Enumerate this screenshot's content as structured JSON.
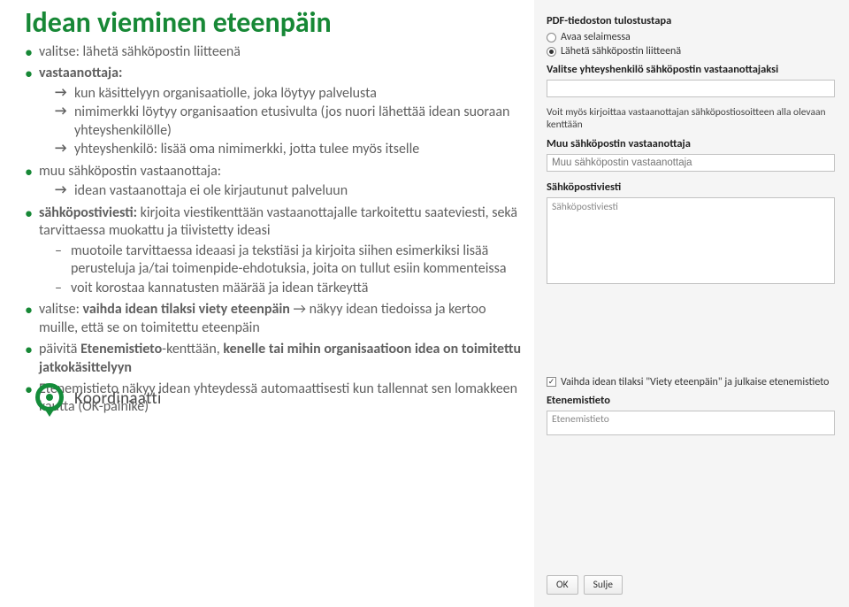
{
  "title": "Idean vieminen eteenpäin",
  "bullets": {
    "b1": "valitse: lähetä sähköpostin liitteenä",
    "b2_lead": "vastaanottaja:",
    "b2_a1": "kun käsittelyyn organisaatiolle, joka löytyy palvelusta",
    "b2_a2": "nimimerkki löytyy organisaation etusivulta (jos nuori lähettää idean suoraan yhteyshenkilölle)",
    "b2_a3": "yhteyshenkilö: lisää oma nimimerkki, jotta tulee myös itselle",
    "b3_lead": "muu sähköpostin vastaanottaja:",
    "b3_a1": "idean vastaanottaja ei ole kirjautunut palveluun",
    "b4_pre": "sähköpostiviesti:",
    "b4_rest": " kirjoita viestikenttään vastaanottajalle tarkoitettu saateviesti, sekä tarvittaessa muokattu ja tiivistetty ideasi",
    "b4_d1": "muotoile tarvittaessa ideaasi ja tekstiäsi ja kirjoita siihen esimerkiksi lisää perusteluja ja/tai toimenpide-ehdotuksia, joita on tullut esiin kommenteissa",
    "b4_d2": "voit korostaa kannatusten määrää ja idean tärkeyttä",
    "b5_pre": "valitse: ",
    "b5_bold": "vaihda idean tilaksi viety eteenpäin",
    "b5_rest": " → näkyy idean tiedoissa ja kertoo muille, että se on toimitettu eteenpäin",
    "b6_pre": "päivitä ",
    "b6_bold1": "Etenemistieto",
    "b6_mid": "-kenttään, ",
    "b6_bold2": "kenelle tai mihin organisaatioon idea on toimitettu jatkokäsittelyyn",
    "b7": "Etenemistieto näkyy idean yhteydessä automaattisesti kun tallennat sen lomakkeen kautta (OK-painike)"
  },
  "logo": {
    "text": "Koordinaatti"
  },
  "form": {
    "h1": "PDF-tiedoston tulostustapa",
    "r1": "Avaa selaimessa",
    "r2": "Lähetä sähköpostin liitteenä",
    "h2": "Valitse yhteyshenkilö sähköpostin vastaanottajaksi",
    "note1": "Voit myös kirjoittaa vastaanottajan sähköpostiosoitteen alla olevaan kenttään",
    "h3": "Muu sähköpostin vastaanottaja",
    "ph_muu": "Muu sähköpostin vastaanottaja",
    "h4": "Sähköpostiviesti",
    "ph_viesti": "Sähköpostiviesti",
    "chk": "Vaihda idean tilaksi \"Viety eteenpäin\" ja julkaise etenemistieto",
    "h5": "Etenemistieto",
    "ph_et": "Etenemistieto",
    "ok": "OK",
    "cancel": "Sulje"
  }
}
